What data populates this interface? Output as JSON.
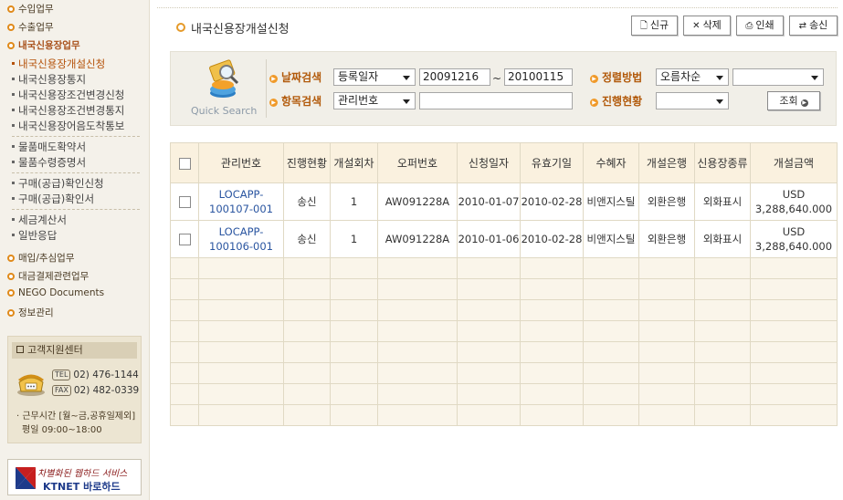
{
  "sidebar": {
    "menus_top": [
      "수입업무",
      "수출업무",
      "내국신용장업무"
    ],
    "submenu_group1": [
      "내국신용장개설신청",
      "내국신용장통지",
      "내국신용장조건변경신청",
      "내국신용장조건변경통지",
      "내국신용장어음도착통보"
    ],
    "submenu_group2": [
      "물품매도확약서",
      "물품수령증명서"
    ],
    "submenu_group3": [
      "구매(공급)확인신청",
      "구매(공급)확인서"
    ],
    "submenu_group4": [
      "세금계산서",
      "일반응답"
    ],
    "menus_bottom": [
      "매입/추심업무",
      "대금결제관련업무",
      "NEGO Documents",
      "정보관리"
    ],
    "support": {
      "title": "고객지원센터",
      "tel_tag": "TEL",
      "tel": "02) 476-1144",
      "fax_tag": "FAX",
      "fax": "02) 482-0339",
      "hours_line1": "· 근무시간 [월~금,공휴일제외]",
      "hours_line2": "평일 09:00~18:00"
    },
    "banner": {
      "line1": "차별화된 웹하드 서비스",
      "line2": "KTNET 바로하드"
    }
  },
  "header": {
    "title": "내국신용장개설신청",
    "buttons": [
      "신규",
      "삭제",
      "인쇄",
      "송신"
    ]
  },
  "search": {
    "quick_label": "Quick Search",
    "date_label": "날짜검색",
    "date_type": "등록일자",
    "date_from": "20091216",
    "tilde": "~",
    "date_to": "20100115",
    "sort_label": "정렬방법",
    "sort_value": "오름차순",
    "sort_field": "",
    "item_label": "항목검색",
    "item_type": "관리번호",
    "item_value": "",
    "status_label": "진행현황",
    "status_value": "",
    "search_button": "조회"
  },
  "table": {
    "headers": [
      "관리번호",
      "진행현황",
      "개설회차",
      "오퍼번호",
      "신청일자",
      "유효기일",
      "수혜자",
      "개설은행",
      "신용장종류",
      "개설금액"
    ],
    "rows": [
      {
        "mgmt_no": "LOCAPP-100107-001",
        "status": "송신",
        "round": "1",
        "offer_no": "AW091228A",
        "apply_date": "2010-01-07",
        "expiry": "2010-02-28",
        "beneficiary": "비앤지스틸",
        "bank": "외환은행",
        "lc_type": "외화표시",
        "currency": "USD",
        "amount": "3,288,640.000"
      },
      {
        "mgmt_no": "LOCAPP-100106-001",
        "status": "송신",
        "round": "1",
        "offer_no": "AW091228A",
        "apply_date": "2010-01-06",
        "expiry": "2010-02-28",
        "beneficiary": "비앤지스틸",
        "bank": "외환은행",
        "lc_type": "외화표시",
        "currency": "USD",
        "amount": "3,288,640.000"
      }
    ]
  }
}
